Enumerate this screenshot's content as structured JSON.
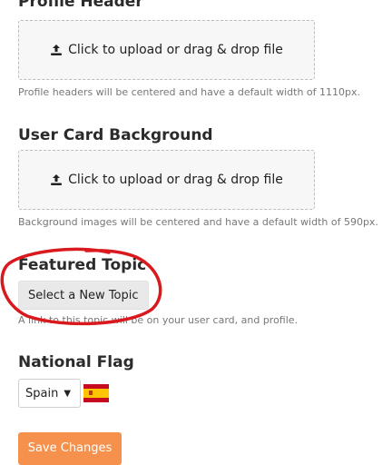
{
  "profile_header": {
    "title": "Profile Header",
    "upload_label": "Click to upload or drag & drop file",
    "help": "Profile headers will be centered and have a default width of 1110px."
  },
  "user_card_background": {
    "title": "User Card Background",
    "upload_label": "Click to upload or drag & drop file",
    "help": "Background images will be centered and have a default width of 590px."
  },
  "featured_topic": {
    "title": "Featured Topic",
    "button_label": "Select a New Topic",
    "help": "A link to this topic will be on your user card, and profile."
  },
  "national_flag": {
    "title": "National Flag",
    "selected": "Spain",
    "flag_icon": "spain-flag-icon"
  },
  "actions": {
    "save_label": "Save Changes"
  },
  "colors": {
    "accent": "#f6914d",
    "annotation": "#d9191e"
  },
  "icons": {
    "upload": "upload-icon",
    "caret": "caret-down-icon"
  }
}
